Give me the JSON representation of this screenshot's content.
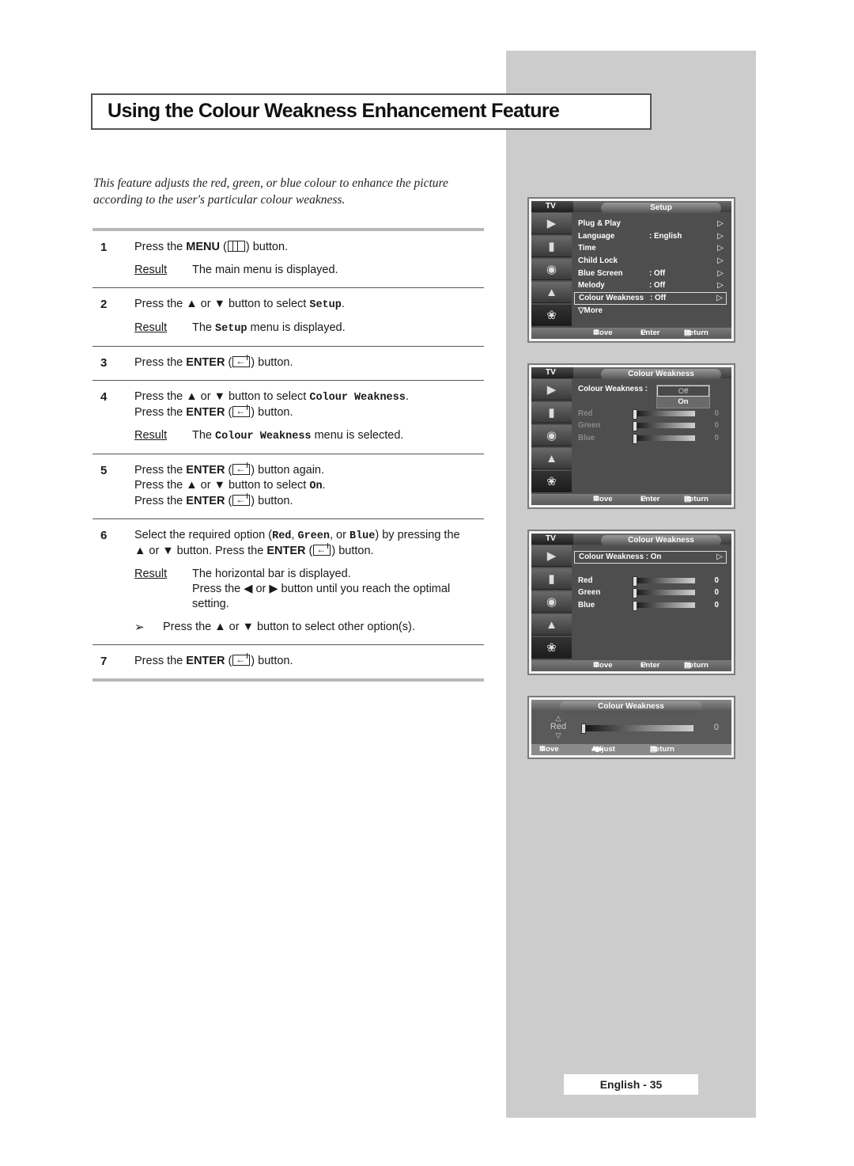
{
  "title": "Using the Colour Weakness Enhancement Feature",
  "intro": "This feature adjusts the red, green, or blue colour to enhance the picture according to the user's particular colour weakness.",
  "result_label": "Result",
  "steps": [
    {
      "num": "1",
      "a": "Press the ",
      "b": "MENU",
      "c": " button.",
      "result": "The main menu is displayed."
    },
    {
      "num": "2",
      "a": "Press the ▲ or ▼ button to select ",
      "code": "Setup",
      "c": ".",
      "result_a": "The ",
      "result_code": "Setup",
      "result_c": " menu is displayed."
    },
    {
      "num": "3",
      "a": "Press the ",
      "b": "ENTER",
      "c": " button."
    },
    {
      "num": "4",
      "a": "Press the ▲ or ▼ button to select ",
      "code": "Colour Weakness",
      "c": ".",
      "line2_a": "Press the ",
      "line2_b": "ENTER",
      "line2_c": " button.",
      "result_a": "The ",
      "result_code": "Colour Weakness",
      "result_c": " menu is selected."
    },
    {
      "num": "5",
      "a": "Press the ",
      "b": "ENTER",
      "c": " button again.",
      "line2_a": "Press the ▲ or ▼ button to select ",
      "line2_code": "On",
      "line2_c": ".",
      "line3_a": "Press the ",
      "line3_b": "ENTER",
      "line3_c": " button."
    },
    {
      "num": "6",
      "a": "Select the required option (",
      "code1": "Red",
      "sep1": ", ",
      "code2": "Green",
      "sep2": ", or ",
      "code3": "Blue",
      "c": ") by pressing the",
      "line2_a": "▲ or ▼ button. Press the ",
      "line2_b": "ENTER",
      "line2_c": " button.",
      "result": "The horizontal bar is displayed.",
      "result2": "Press the ◀ or ▶ button until you reach the optimal",
      "result3": "setting.",
      "note": "Press the ▲ or ▼ button to select other option(s)."
    },
    {
      "num": "7",
      "a": "Press the ",
      "b": "ENTER",
      "c": " button."
    }
  ],
  "tv_common": {
    "tab": "TV",
    "footer_move": "Move",
    "footer_enter": "Enter",
    "footer_return": "Return",
    "footer_adjust": "Adjust"
  },
  "screen1": {
    "header": "Setup",
    "rows": [
      {
        "label": "Plug & Play",
        "value": ""
      },
      {
        "label": "Language",
        "value": ": English"
      },
      {
        "label": "Time",
        "value": ""
      },
      {
        "label": "Child Lock",
        "value": ""
      },
      {
        "label": "Blue Screen",
        "value": ": Off"
      },
      {
        "label": "Melody",
        "value": ": Off"
      },
      {
        "label": "Colour Weakness",
        "value": ": Off"
      }
    ],
    "more": "More"
  },
  "screen2": {
    "header": "Colour Weakness",
    "label": "Colour Weakness :",
    "options": [
      "Off",
      "On"
    ],
    "sliders": [
      {
        "label": "Red",
        "value": "0"
      },
      {
        "label": "Green",
        "value": "0"
      },
      {
        "label": "Blue",
        "value": "0"
      }
    ]
  },
  "screen3": {
    "header": "Colour Weakness",
    "label": "Colour Weakness : On",
    "sliders": [
      {
        "label": "Red",
        "value": "0"
      },
      {
        "label": "Green",
        "value": "0"
      },
      {
        "label": "Blue",
        "value": "0"
      }
    ]
  },
  "screen4": {
    "header": "Colour Weakness",
    "label": "Red",
    "value": "0"
  },
  "page_number": "English - 35"
}
